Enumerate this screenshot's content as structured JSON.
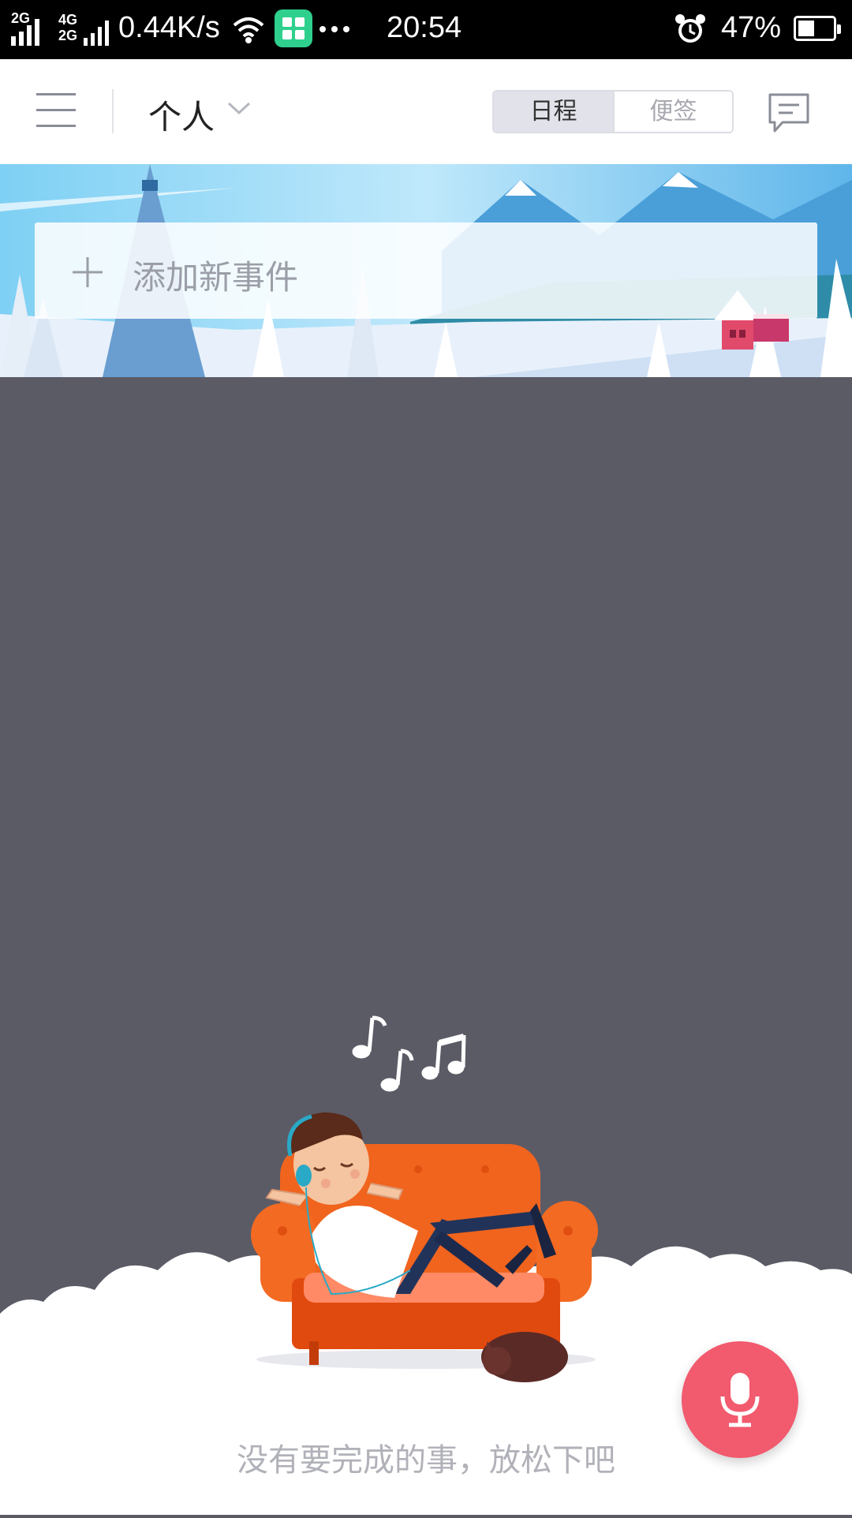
{
  "status_bar": {
    "net_type_top": "2G",
    "net2_top": "4G",
    "net2_bottom": "2G",
    "speed": "0.44K/s",
    "time": "20:54",
    "battery": "47%",
    "battery_level": 0.47,
    "icons": [
      "signal-icon",
      "wifi-icon",
      "app-notification-icon",
      "more-dots-icon",
      "alarm-icon",
      "battery-icon"
    ]
  },
  "header": {
    "title": "个人",
    "segment": {
      "active": "日程",
      "inactive": "便签"
    },
    "icons": [
      "menu-icon",
      "chevron-down-icon",
      "message-icon"
    ]
  },
  "add_event": {
    "placeholder": "添加新事件",
    "icon": "plus-icon"
  },
  "empty_state": {
    "message": "没有要完成的事，放松下吧"
  },
  "fab": {
    "icon": "microphone-icon",
    "color": "#f25a6e"
  },
  "colors": {
    "background": "#5b5b66",
    "accent": "#f25a6e",
    "sofa": "#f0641e"
  }
}
